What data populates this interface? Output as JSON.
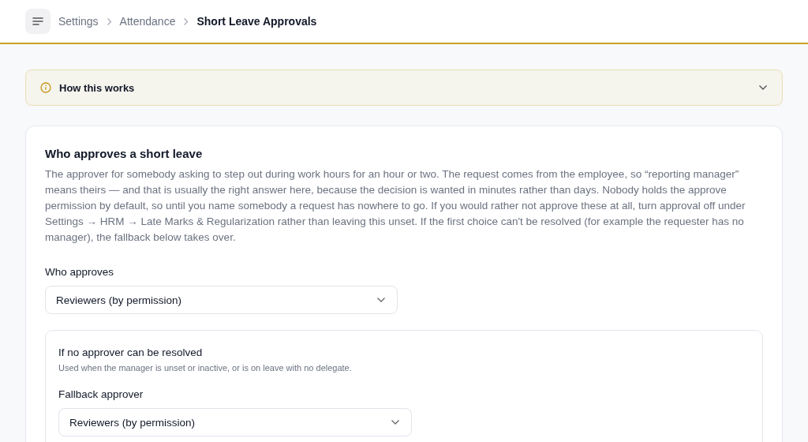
{
  "breadcrumb": [
    {
      "label": "Settings",
      "current": false
    },
    {
      "label": "Attendance",
      "current": false
    },
    {
      "label": "Short Leave Approvals",
      "current": true
    }
  ],
  "notice": {
    "title": "How this works",
    "expanded": false
  },
  "section": {
    "title": "Who approves a short leave",
    "description": "The approver for somebody asking to step out during work hours for an hour or two. The request comes from the employee, so “reporting manager” means theirs — and that is usually the right answer here, because the decision is wanted in minutes rather than days. Nobody holds the approve permission by default, so until you name somebody a request has nowhere to go. If you would rather not approve these at all, turn approval off under Settings → HRM → Late Marks & Regularization rather than leaving this unset. If the first choice can't be resolved (for example the requester has no manager), the fallback below takes over.",
    "approver": {
      "label": "Who approves",
      "value": "Reviewers (by permission)"
    },
    "fallback": {
      "title": "If no approver can be resolved",
      "hint": "Used when the manager is unset or inactive, or is on leave with no delegate.",
      "label": "Fallback approver",
      "value": "Reviewers (by permission)"
    }
  }
}
